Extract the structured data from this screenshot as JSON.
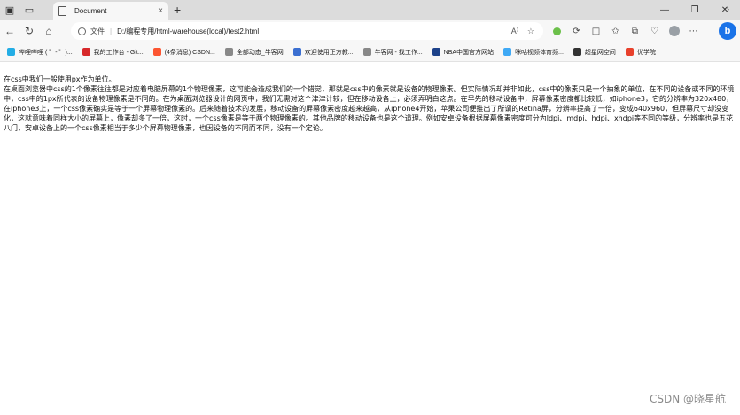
{
  "tab": {
    "title": "Document",
    "close": "×"
  },
  "new_tab": "+",
  "window_controls": {
    "minimize": "—",
    "restore": "❐",
    "close": "✕"
  },
  "nav": {
    "back": "←",
    "reload": "↻",
    "home": "⌂"
  },
  "address": {
    "file_label": "文件",
    "separator": "|",
    "url": "D:/编程专用/html-warehouse(local)/test2.html",
    "read_aloud": "A⁾",
    "favorite": "☆"
  },
  "toolbar_icons": [
    "extension-icon",
    "refresh-extension-icon",
    "split-screen-icon",
    "favorites-icon",
    "collections-icon",
    "history-icon",
    "profile-icon",
    "more-icon"
  ],
  "bookmarks": [
    {
      "label": "哔哩哔哩 ( ゜- ゜)...",
      "color": "#23ade5"
    },
    {
      "label": "我的工作台 - Git...",
      "color": "#d7282a"
    },
    {
      "label": "(4条消息) CSDN...",
      "color": "#fc5531"
    },
    {
      "label": "全部动态_牛客网",
      "color": "#888888"
    },
    {
      "label": "欢迎使用正方教...",
      "color": "#3b6fd1"
    },
    {
      "label": "牛客网 - 找工作...",
      "color": "#888888"
    },
    {
      "label": "NBA中国官方网站",
      "color": "#1d428a"
    },
    {
      "label": "咪咕视频体育频...",
      "color": "#3fa9f5"
    },
    {
      "label": "超星网空间",
      "color": "#333333"
    },
    {
      "label": "优学院",
      "color": "#e8412c"
    }
  ],
  "bookmarks_more": "›",
  "content": {
    "line1": "在css中我们一般使用px作为单位。",
    "paragraph": "在桌面浏览器中css的1个像素往往都是对应着电脑屏幕的1个物理像素，这可能会造成我们的一个错觉，那就是css中的像素就是设备的物理像素。但实际情况却并非如此，css中的像素只是一个抽象的单位，在不同的设备或不同的环境中，css中的1px所代表的设备物理像素是不同的。在为桌面浏览器设计的网页中，我们无需对这个津津计较，但在移动设备上，必须弄明白这点。在早先的移动设备中，屏幕像素密度都比较低，如iphone3，它的分辨率为320x480，在iphone3上，一个css像素确实是等于一个屏幕物理像素的。后来随着技术的发展，移动设备的屏幕像素密度越来越高，从iphone4开始，苹果公司便推出了所谓的Retina屏，分辨率提高了一倍，变成640x960，但屏幕尺寸却没变化，这就意味着同样大小的屏幕上，像素却多了一倍，这时，一个css像素是等于两个物理像素的。其他品牌的移动设备也是这个道理。例如安卓设备根据屏幕像素密度可分为ldpi、mdpi、hdpi、xhdpi等不同的等级，分辨率也是五花八门，安卓设备上的一个css像素相当于多少个屏幕物理像素，也因设备的不同而不同，没有一个定论。"
  },
  "watermark": "CSDN @晓星航"
}
